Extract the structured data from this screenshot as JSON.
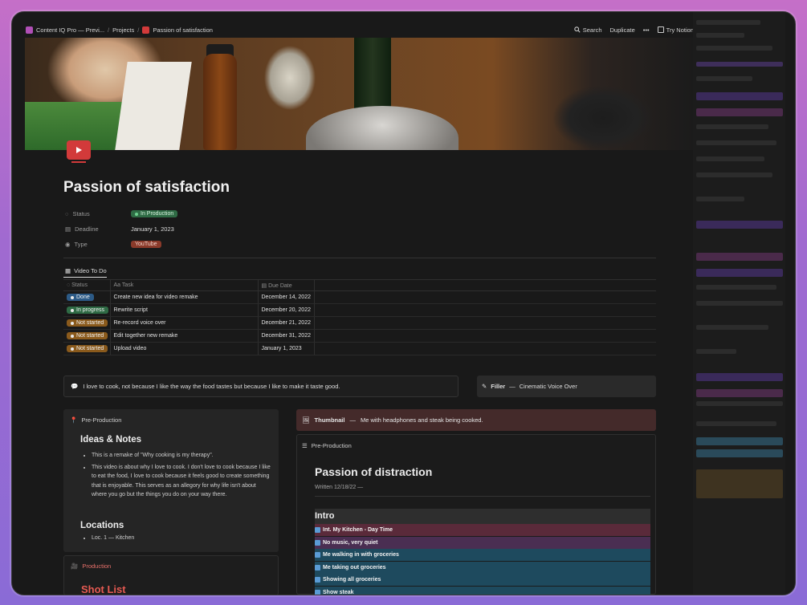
{
  "topbar": {
    "breadcrumbs": [
      "Content IQ Pro — Previ...",
      "Projects",
      "Passion of satisfaction"
    ],
    "search": "Search",
    "duplicate": "Duplicate",
    "more": "•••",
    "try_notion": "Try Notion"
  },
  "page": {
    "title": "Passion of satisfaction",
    "properties": [
      {
        "key": "Status",
        "value": "In Production",
        "color": "#2f6b45"
      },
      {
        "key": "Deadline",
        "value": "January 1, 2023"
      },
      {
        "key": "Type",
        "value": "YouTube",
        "color": "#8a3a2a"
      }
    ]
  },
  "database": {
    "title": "Video To Do",
    "columns": [
      "Status",
      "Task",
      "Due Date"
    ],
    "rows": [
      {
        "status": "Done",
        "status_color": "#2c5a86",
        "task": "Create new idea for video remake",
        "due": "December 14, 2022"
      },
      {
        "status": "In progress",
        "status_color": "#2f6b45",
        "task": "Rewrite script",
        "due": "December 20, 2022"
      },
      {
        "status": "Not started",
        "status_color": "#8a5a1c",
        "task": "Re-record voice over",
        "due": "December 21, 2022"
      },
      {
        "status": "Not started",
        "status_color": "#8a5a1c",
        "task": "Edit together new remake",
        "due": "December 31, 2022"
      },
      {
        "status": "Not started",
        "status_color": "#8a5a1c",
        "task": "Upload video",
        "due": "January 1, 2023"
      }
    ]
  },
  "quote": "I love to cook, not because I like the way the food tastes but because I like to make it taste good.",
  "filler": {
    "label": "Filler",
    "sep": "—",
    "text": "Cinematic Voice Over"
  },
  "preproduction": {
    "head": "Pre-Production",
    "ideas_heading": "Ideas & Notes",
    "ideas": [
      "This is a remake of \"Why cooking is my therapy\".",
      "This video is about why I love to cook. I don't love to cook because I like to eat the food, I love to cook because it feels good to create something that is enjoyable. This serves as an allegory for why life isn't about where you go but the things you do on your way there."
    ],
    "locations_heading": "Locations",
    "locations": [
      "Loc. 1 — Kitchen"
    ]
  },
  "production": {
    "head": "Production",
    "heading": "Shot List"
  },
  "thumbnail": {
    "label": "Thumbnail",
    "sep": "—",
    "text": "Me with headphones and steak being cooked."
  },
  "script": {
    "head": "Pre-Production",
    "title": "Passion of distraction",
    "written": "Written 12/18/22 —",
    "section": "Intro",
    "scenes": [
      {
        "text": "Int. My Kitchen - Day Time",
        "color": "#5a2a3a"
      },
      {
        "text": "No music, very quiet",
        "color": "#4a2e52"
      },
      {
        "text": "Me walking in with groceries",
        "color": "#1e4a5e"
      },
      {
        "text": "Me taking out groceries",
        "color": "#1e4a5e"
      },
      {
        "text": "Showing all groceries",
        "color": "#1e4a5e"
      },
      {
        "text": "Show steak",
        "color": "#1e4a5e"
      }
    ]
  }
}
